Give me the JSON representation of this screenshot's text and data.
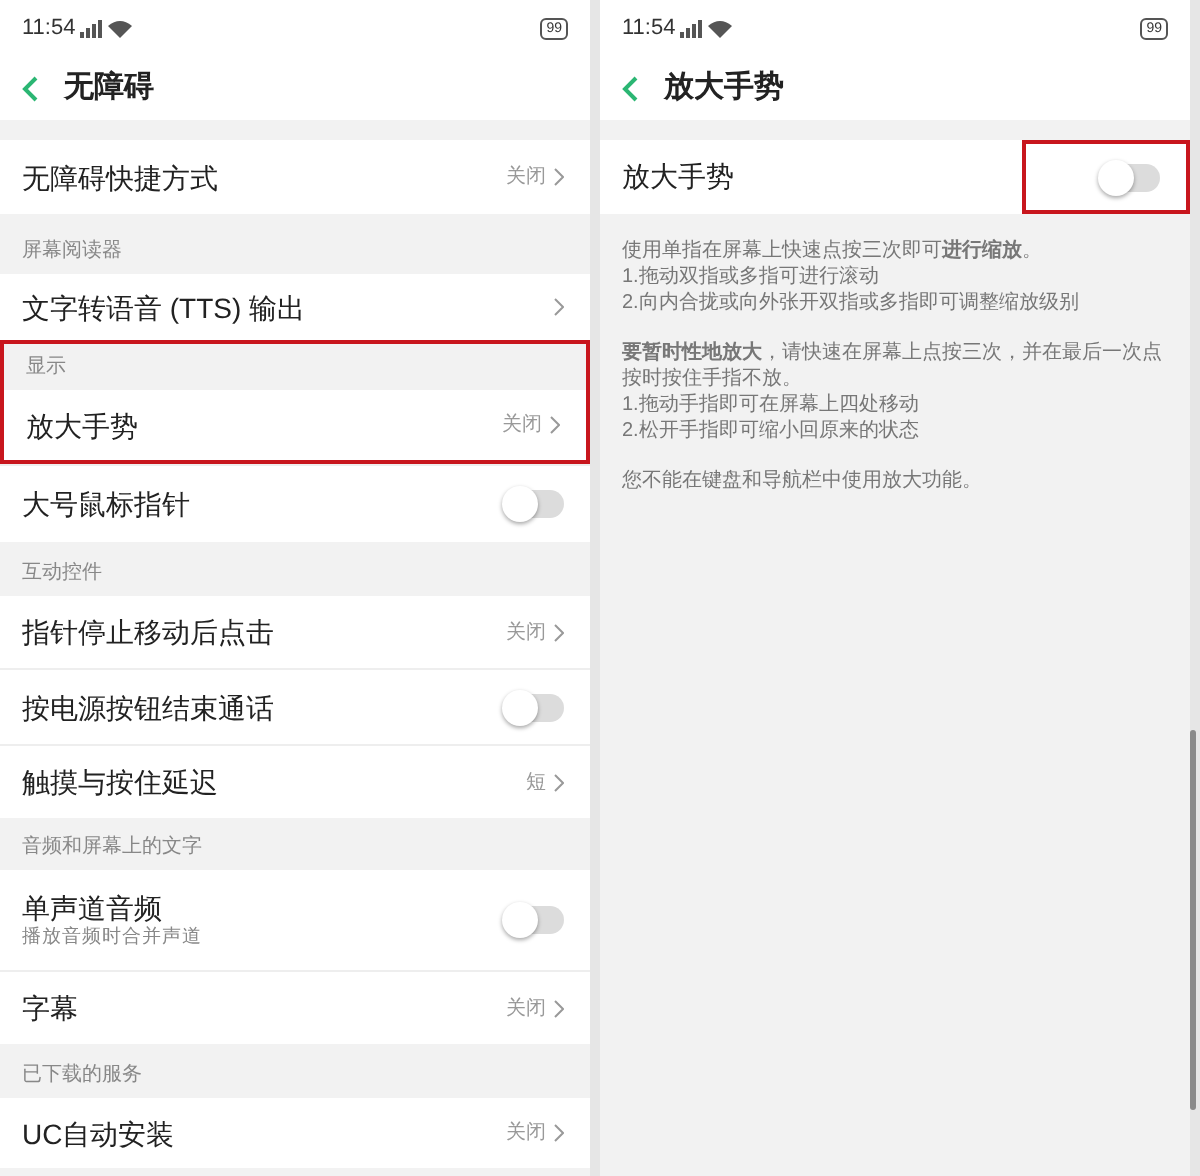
{
  "left_screen": {
    "status_bar": {
      "time": "11:54",
      "battery": "99"
    },
    "header": {
      "title": "无障碍"
    },
    "groups": [
      {
        "items": [
          {
            "kind": "link",
            "title": "无障碍快捷方式",
            "value": "关闭",
            "highlighted": false
          }
        ]
      },
      {
        "header": "屏幕阅读器",
        "highlighted": false,
        "items": [
          {
            "kind": "link",
            "title": "文字转语音 (TTS) 输出",
            "highlighted": false
          }
        ]
      },
      {
        "header": "显示",
        "highlighted": true,
        "items": [
          {
            "kind": "link",
            "title": "放大手势",
            "value": "关闭",
            "highlighted": true
          },
          {
            "kind": "toggle",
            "title": "大号鼠标指针",
            "on": false,
            "highlighted": false
          }
        ]
      },
      {
        "header": "互动控件",
        "highlighted": false,
        "items": [
          {
            "kind": "link",
            "title": "指针停止移动后点击",
            "value": "关闭",
            "highlighted": false
          },
          {
            "kind": "toggle",
            "title": "按电源按钮结束通话",
            "on": false,
            "highlighted": false
          },
          {
            "kind": "link",
            "title": "触摸与按住延迟",
            "value": "短",
            "highlighted": false
          }
        ]
      },
      {
        "header": "音频和屏幕上的文字",
        "highlighted": false,
        "items": [
          {
            "kind": "toggle",
            "title": "单声道音频",
            "subtitle": "播放音频时合并声道",
            "on": false,
            "highlighted": false
          },
          {
            "kind": "link",
            "title": "字幕",
            "value": "关闭",
            "highlighted": false
          }
        ]
      },
      {
        "header": "已下载的服务",
        "highlighted": false,
        "items": [
          {
            "kind": "link",
            "title": "UC自动安装",
            "value": "关闭",
            "highlighted": false
          }
        ]
      }
    ]
  },
  "right_screen": {
    "status_bar": {
      "time": "11:54",
      "battery": "99"
    },
    "header": {
      "title": "放大手势"
    },
    "switch_row": {
      "title": "放大手势",
      "on": false,
      "highlighted": true
    },
    "description": [
      [
        "使用单指在屏幕上快速点按三次即可**进行缩放**。",
        "1.拖动双指或多指可进行滚动",
        "2.向内合拢或向外张开双指或多指即可调整缩放级别"
      ],
      [
        "**要暂时性地放大**，请快速在屏幕上点按三次，并在最后一次点按时按住手指不放。",
        "1.拖动手指即可在屏幕上四处移动",
        "2.松开手指即可缩小回原来的状态"
      ],
      [
        "您不能在键盘和导航栏中使用放大功能。"
      ]
    ]
  }
}
